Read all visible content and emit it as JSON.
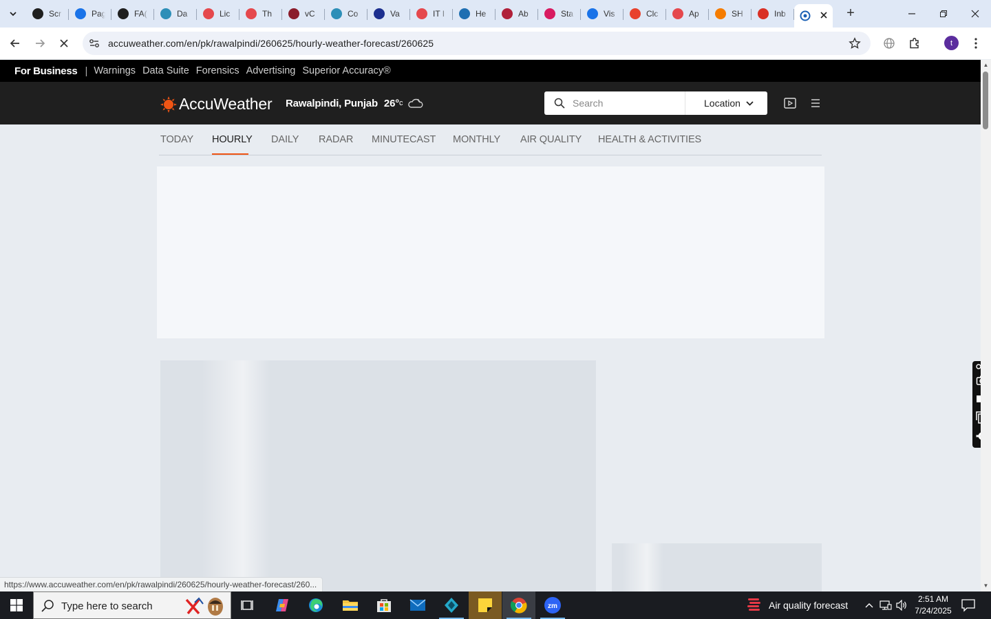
{
  "browser": {
    "tabs": [
      {
        "title": "Scr",
        "icon": "target-icon",
        "color": "#1f1f1f"
      },
      {
        "title": "Pag",
        "icon": "rainbow-icon",
        "color": "#1a73e8"
      },
      {
        "title": "FA(",
        "icon": "openai-icon",
        "color": "#1f1f1f"
      },
      {
        "title": "Da",
        "icon": "circle-play-icon",
        "color": "#2d8fb8"
      },
      {
        "title": "Lic",
        "icon": "hexagon-icon",
        "color": "#e5484d"
      },
      {
        "title": "Th",
        "icon": "hexagon-icon",
        "color": "#e5484d"
      },
      {
        "title": "vC",
        "icon": "v-check-icon",
        "color": "#8b1c2b"
      },
      {
        "title": "Co",
        "icon": "circle-play-icon",
        "color": "#2d8fb8"
      },
      {
        "title": "Va",
        "icon": "x-logo-icon",
        "color": "#1c2f8f"
      },
      {
        "title": "IT I",
        "icon": "hexagon-icon",
        "color": "#e5484d"
      },
      {
        "title": "He",
        "icon": "scales-icon",
        "color": "#1f6fb2"
      },
      {
        "title": "Ab",
        "icon": "ball-icon",
        "color": "#b0203a"
      },
      {
        "title": "Sta",
        "icon": "pen-icon",
        "color": "#d81b60"
      },
      {
        "title": "Vis",
        "icon": "pulse-icon",
        "color": "#1a73e8"
      },
      {
        "title": "Clc",
        "icon": "curve-icon",
        "color": "#e8412c"
      },
      {
        "title": "Ap",
        "icon": "hexagon-icon",
        "color": "#e5484d"
      },
      {
        "title": "SH",
        "icon": "ring-icon",
        "color": "#f57c00"
      },
      {
        "title": "Inb",
        "icon": "gmail-icon",
        "color": "#d93025"
      }
    ],
    "url": "accuweather.com/en/pk/rawalpindi/260625/hourly-weather-forecast/260625",
    "status_url": "https://www.accuweather.com/en/pk/rawalpindi/260625/hourly-weather-forecast/260...",
    "profile_initial": "t"
  },
  "site": {
    "business_bar": {
      "bold": "For Business",
      "links": [
        "Warnings",
        "Data Suite",
        "Forensics",
        "Advertising",
        "Superior Accuracy®"
      ]
    },
    "logo": "AccuWeather",
    "location": "Rawalpindi, Punjab",
    "temp": "26°",
    "temp_unit": "c",
    "search_placeholder": "Search",
    "location_button": "Location",
    "nav": [
      "TODAY",
      "HOURLY",
      "DAILY",
      "RADAR",
      "MINUTECAST",
      "MONTHLY",
      "AIR QUALITY",
      "HEALTH & ACTIVITIES"
    ],
    "active_nav": "HOURLY",
    "accent": "#f05514"
  },
  "taskbar": {
    "search_placeholder": "Type here to search",
    "weather_widget": "Air quality forecast",
    "time": "2:51 AM",
    "date": "7/24/2025"
  }
}
